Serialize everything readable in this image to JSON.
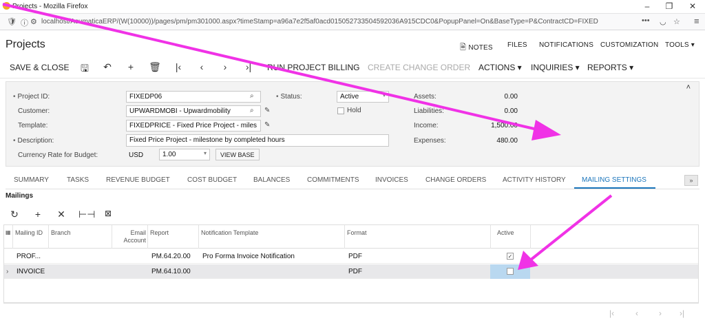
{
  "browser": {
    "window_title": "Projects - Mozilla Firefox",
    "url_prefix": "localhost/AcumaticaERP/(W(10000))/pages/pm/pm301000.aspx?timeStamp=a96a7e2f5af0acd015052733504592036A915CDC0&PopupPanel=On&BaseType=P&ContractCD=FIXED",
    "url_more": "•••"
  },
  "page": {
    "title": "Projects",
    "top_links": [
      "NOTES",
      "FILES",
      "NOTIFICATIONS",
      "CUSTOMIZATION",
      "TOOLS ▾"
    ]
  },
  "toolbar": {
    "save_close": "SAVE & CLOSE",
    "run_billing": "RUN PROJECT BILLING",
    "create_change_order": "CREATE CHANGE ORDER",
    "actions": "ACTIONS ▾",
    "inquiries": "INQUIRIES ▾",
    "reports": "REPORTS ▾"
  },
  "form": {
    "project_id_label": "Project ID:",
    "project_id": "FIXEDP06",
    "customer_label": "Customer:",
    "customer": "UPWARDMOBI - Upwardmobility",
    "template_label": "Template:",
    "template": "FIXEDPRICE - Fixed Price Project - miles",
    "description_label": "Description:",
    "description": "Fixed Price Project - milestone by completed hours",
    "currency_label": "Currency Rate for Budget:",
    "currency": "USD",
    "rate": "1.00",
    "view_base": "VIEW BASE",
    "status_label": "Status:",
    "status": "Active",
    "hold_label": "Hold",
    "assets_label": "Assets:",
    "assets": "0.00",
    "liabilities_label": "Liabilities:",
    "liabilities": "0.00",
    "income_label": "Income:",
    "income": "1,500.00",
    "expenses_label": "Expenses:",
    "expenses": "480.00"
  },
  "tabs": [
    "SUMMARY",
    "TASKS",
    "REVENUE BUDGET",
    "COST BUDGET",
    "BALANCES",
    "COMMITMENTS",
    "INVOICES",
    "CHANGE ORDERS",
    "ACTIVITY HISTORY",
    "MAILING SETTINGS"
  ],
  "active_tab": "MAILING SETTINGS",
  "grid": {
    "title": "Mailings",
    "headers": {
      "mailing_id": "Mailing ID",
      "branch": "Branch",
      "email_account": "Email Account",
      "report": "Report",
      "notification_template": "Notification Template",
      "format": "Format",
      "active": "Active"
    },
    "rows": [
      {
        "mailing_id": "PROF...",
        "report": "PM.64.20.00",
        "template": "Pro Forma Invoice Notification",
        "format": "PDF",
        "active": true
      },
      {
        "mailing_id": "INVOICE",
        "report": "PM.64.10.00",
        "template": "",
        "format": "PDF",
        "active": false
      }
    ]
  },
  "colors": {
    "accent": "#1b75bb",
    "annotation_arrow": "#f032e6"
  }
}
